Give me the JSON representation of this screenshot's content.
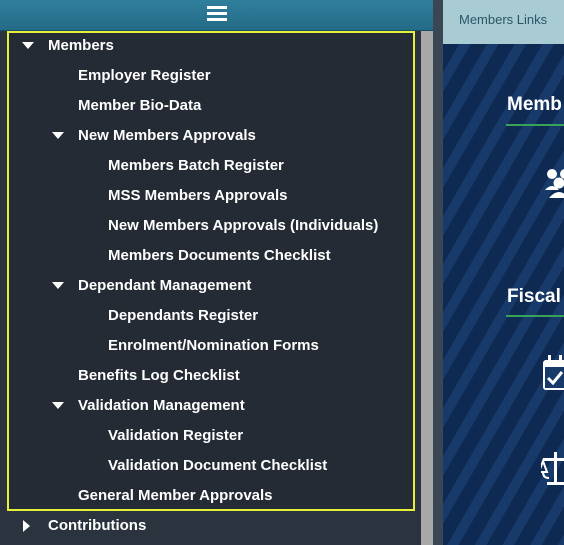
{
  "nav": {
    "tree": [
      {
        "label": "Members",
        "level": 0,
        "caret": "down"
      },
      {
        "label": "Employer Register",
        "level": 1,
        "caret": "none"
      },
      {
        "label": "Member Bio-Data",
        "level": 1,
        "caret": "none"
      },
      {
        "label": "New Members Approvals",
        "level": 1,
        "caret": "down"
      },
      {
        "label": "Members Batch Register",
        "level": 2,
        "caret": "none"
      },
      {
        "label": "MSS Members Approvals",
        "level": 2,
        "caret": "none"
      },
      {
        "label": "New Members Approvals (Individuals)",
        "level": 2,
        "caret": "none"
      },
      {
        "label": "Members Documents Checklist",
        "level": 2,
        "caret": "none"
      },
      {
        "label": "Dependant Management",
        "level": 1,
        "caret": "down"
      },
      {
        "label": "Dependants Register",
        "level": 2,
        "caret": "none"
      },
      {
        "label": "Enrolment/Nomination Forms",
        "level": 2,
        "caret": "none"
      },
      {
        "label": "Benefits Log Checklist",
        "level": 1,
        "caret": "none"
      },
      {
        "label": "Validation Management",
        "level": 1,
        "caret": "down"
      },
      {
        "label": "Validation Register",
        "level": 2,
        "caret": "none"
      },
      {
        "label": "Validation Document Checklist",
        "level": 2,
        "caret": "none"
      },
      {
        "label": "General Member Approvals",
        "level": 1,
        "caret": "none"
      },
      {
        "label": "Contributions",
        "level": 0,
        "caret": "right"
      }
    ]
  },
  "right": {
    "tab_label": "Members Links",
    "section1_title": "Memb",
    "section2_title": "Fiscal"
  },
  "icons": {
    "menu": "hamburger-icon",
    "members": "users-icon",
    "fiscal_calendar": "calendar-check-icon",
    "fiscal_scale": "balance-scale-icon"
  },
  "colors": {
    "header": "#2f7f9c",
    "highlight_border": "#e6f03a",
    "tab": "#a9cbd4",
    "section_underline": "#37a35a"
  }
}
